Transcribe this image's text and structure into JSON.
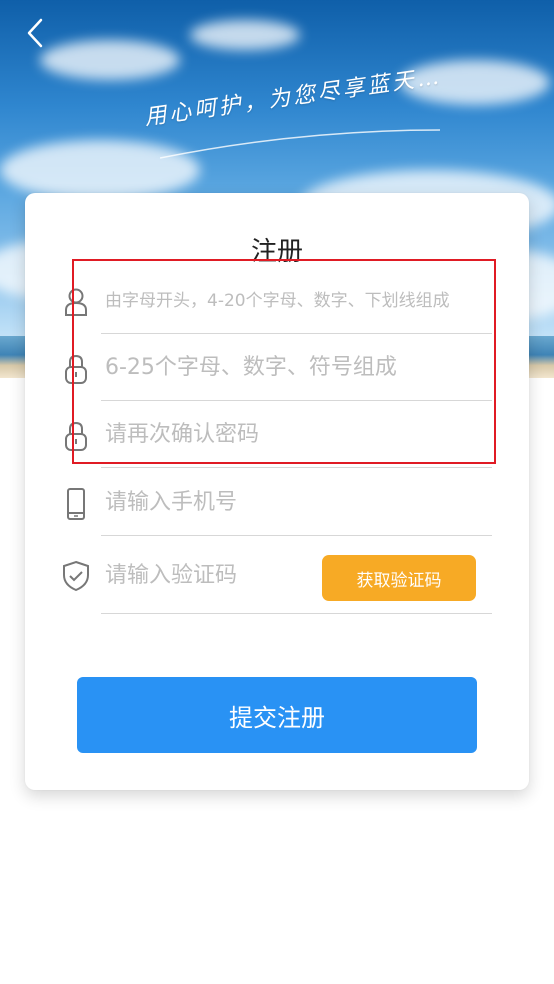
{
  "header": {
    "back_icon": "chevron-left-icon",
    "slogan": "用心呵护，为您尽享蓝天…"
  },
  "form": {
    "title": "注册",
    "fields": [
      {
        "icon": "user-icon",
        "placeholder": "由字母开头，4-20个字母、数字、下划线组成"
      },
      {
        "icon": "lock-icon",
        "placeholder": "6-25个字母、数字、符号组成"
      },
      {
        "icon": "lock-icon",
        "placeholder": "请再次确认密码"
      },
      {
        "icon": "phone-icon",
        "placeholder": "请输入手机号"
      },
      {
        "icon": "shield-check-icon",
        "placeholder": "请输入验证码"
      }
    ],
    "get_code_label": "获取验证码",
    "submit_label": "提交注册"
  },
  "colors": {
    "accent_blue": "#2992f4",
    "code_button_orange": "#f7aa25",
    "highlight_red": "#e01b24"
  }
}
